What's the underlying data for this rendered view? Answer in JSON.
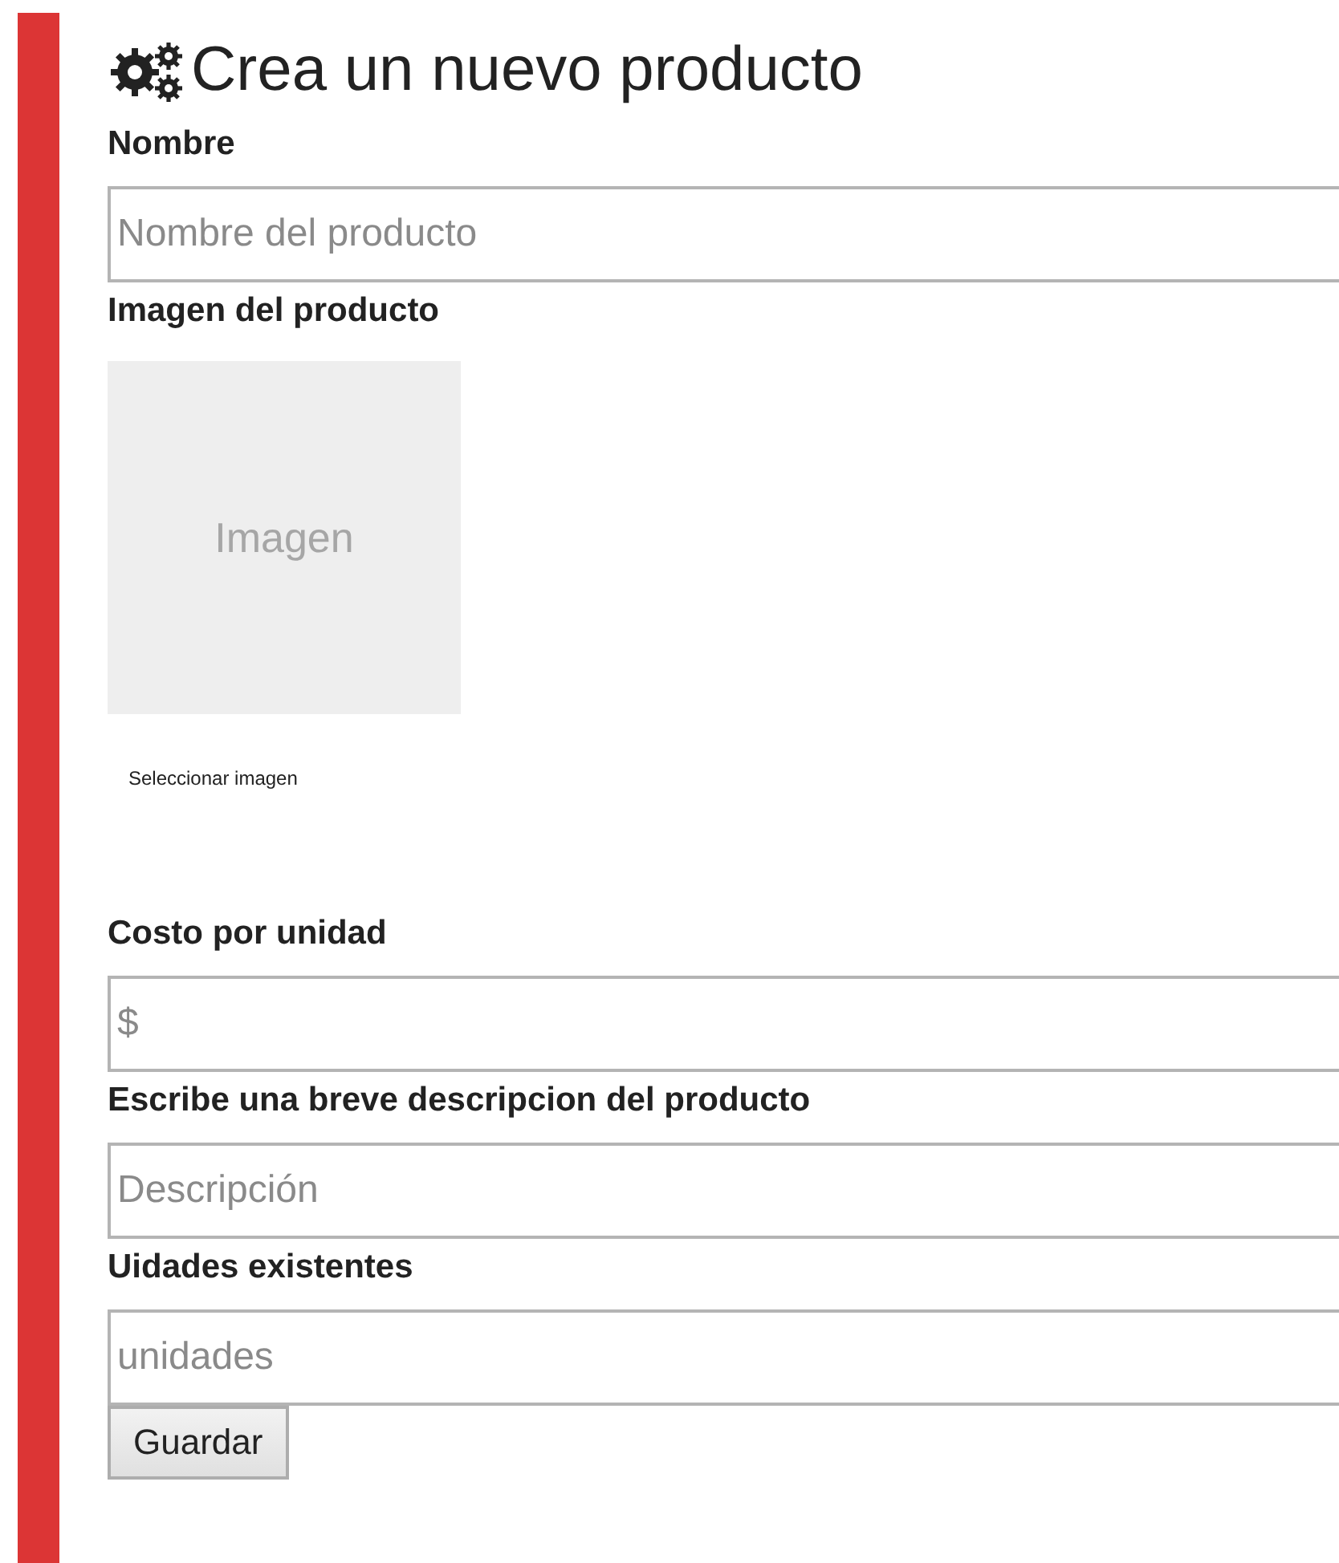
{
  "title": "Crea un nuevo producto",
  "sections": [
    {
      "kind": "text-field",
      "label": "Nombre",
      "placeholder": "Nombre del producto"
    },
    {
      "kind": "image",
      "label": "Imagen del producto",
      "image_text": "Imagen",
      "link": "Seleccionar imagen"
    },
    {
      "kind": "text-field",
      "label": "Costo por unidad",
      "placeholder": "$"
    },
    {
      "kind": "text-field",
      "label": "Escribe una breve descripcion del producto",
      "placeholder": "Descripción"
    },
    {
      "kind": "text-field",
      "label": "Uidades existentes",
      "placeholder": "unidades"
    }
  ],
  "button": "Guardar"
}
